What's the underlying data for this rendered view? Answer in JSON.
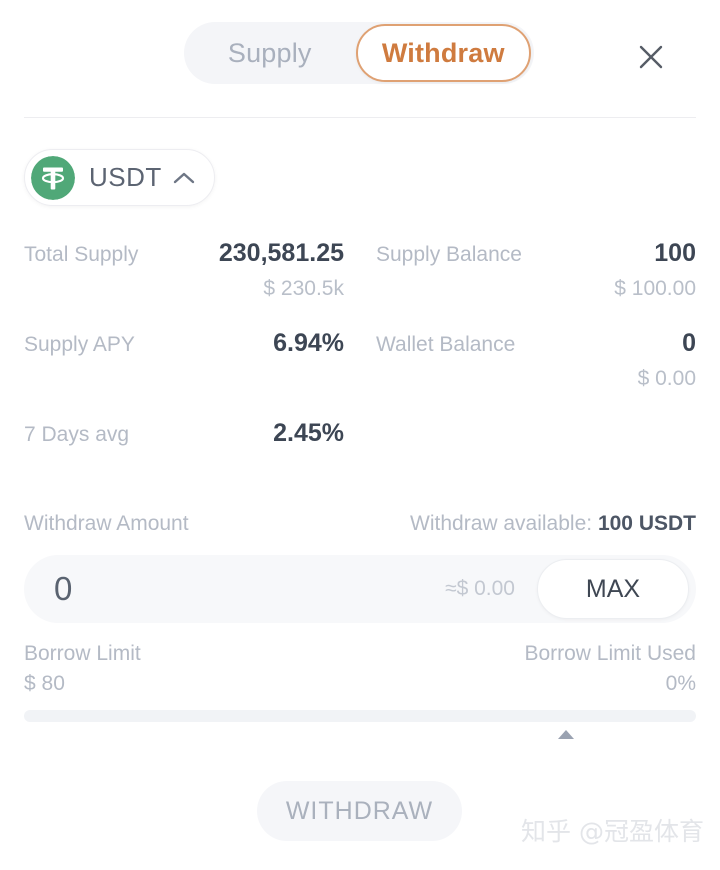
{
  "header": {
    "tabs": [
      {
        "label": "Supply",
        "active": false
      },
      {
        "label": "Withdraw",
        "active": true
      }
    ],
    "close_icon": "close-icon"
  },
  "token": {
    "symbol": "USDT",
    "logo_icon": "tether-logo-icon",
    "logo_color": "#50a878",
    "chevron_icon": "chevron-up-icon"
  },
  "stats": [
    {
      "label": "Total Supply",
      "value": "230,581.25",
      "sub": "$ 230.5k"
    },
    {
      "label": "Supply Balance",
      "value": "100",
      "sub": "$ 100.00"
    },
    {
      "label": "Supply APY",
      "value": "6.94%",
      "sub": ""
    },
    {
      "label": "Wallet Balance",
      "value": "0",
      "sub": "$ 0.00"
    },
    {
      "label": "7 Days avg",
      "value": "2.45%",
      "sub": ""
    }
  ],
  "amount": {
    "label": "Withdraw Amount",
    "available_label": "Withdraw available:",
    "available_value": "100 USDT",
    "input_value": "0",
    "input_placeholder": "0",
    "usd_equivalent": "≈$ 0.00",
    "max_label": "MAX"
  },
  "borrow": {
    "limit_label": "Borrow Limit",
    "limit_value": "$ 80",
    "used_label": "Borrow Limit Used",
    "used_value": "0%",
    "used_percent": 0
  },
  "submit": {
    "label": "WITHDRAW"
  },
  "watermark": {
    "text": "知乎 @冠盈体育"
  },
  "colors": {
    "accent": "#cf7b3f",
    "accent_border": "#dfa173",
    "text_primary": "#3d4654",
    "text_muted": "#b4bac5",
    "tab_bg": "#f4f5f8",
    "field_bg": "#f7f8fa",
    "token_green": "#50a878"
  }
}
